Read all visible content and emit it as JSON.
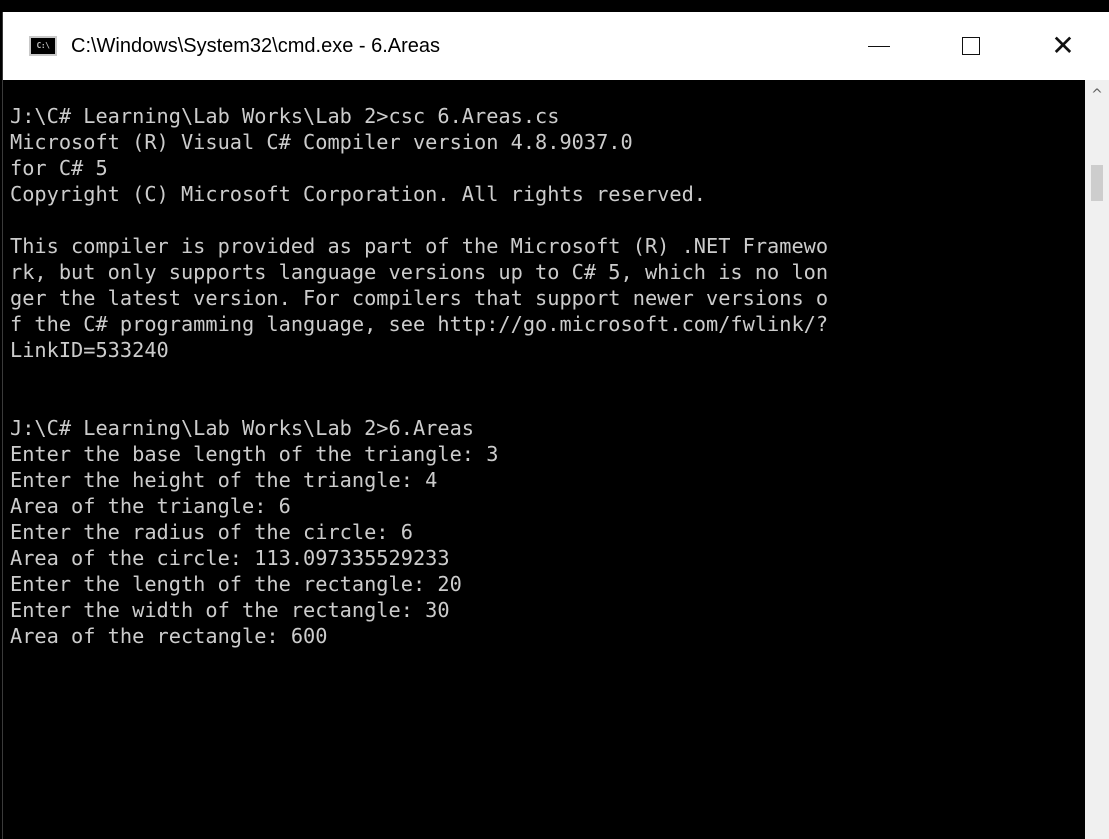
{
  "window": {
    "title": "C:\\Windows\\System32\\cmd.exe - 6.Areas",
    "icon_label": "C:\\",
    "minimize_glyph": "minimize",
    "maximize_glyph": "maximize",
    "close_glyph": "✕"
  },
  "console": {
    "lines": [
      "J:\\C# Learning\\Lab Works\\Lab 2>csc 6.Areas.cs",
      "Microsoft (R) Visual C# Compiler version 4.8.9037.0",
      "for C# 5",
      "Copyright (C) Microsoft Corporation. All rights reserved.",
      "",
      "This compiler is provided as part of the Microsoft (R) .NET Framewo",
      "rk, but only supports language versions up to C# 5, which is no lon",
      "ger the latest version. For compilers that support newer versions o",
      "f the C# programming language, see http://go.microsoft.com/fwlink/?",
      "LinkID=533240",
      "",
      "",
      "J:\\C# Learning\\Lab Works\\Lab 2>6.Areas",
      "Enter the base length of the triangle: 3",
      "Enter the height of the triangle: 4",
      "Area of the triangle: 6",
      "Enter the radius of the circle: 6",
      "Area of the circle: 113.097335529233",
      "Enter the length of the rectangle: 20",
      "Enter the width of the rectangle: 30",
      "Area of the rectangle: 600"
    ]
  },
  "scrollbar": {
    "up_arrow": "^"
  },
  "colors": {
    "console_bg": "#000000",
    "console_fg": "#cccccc",
    "titlebar_bg": "#ffffff"
  }
}
